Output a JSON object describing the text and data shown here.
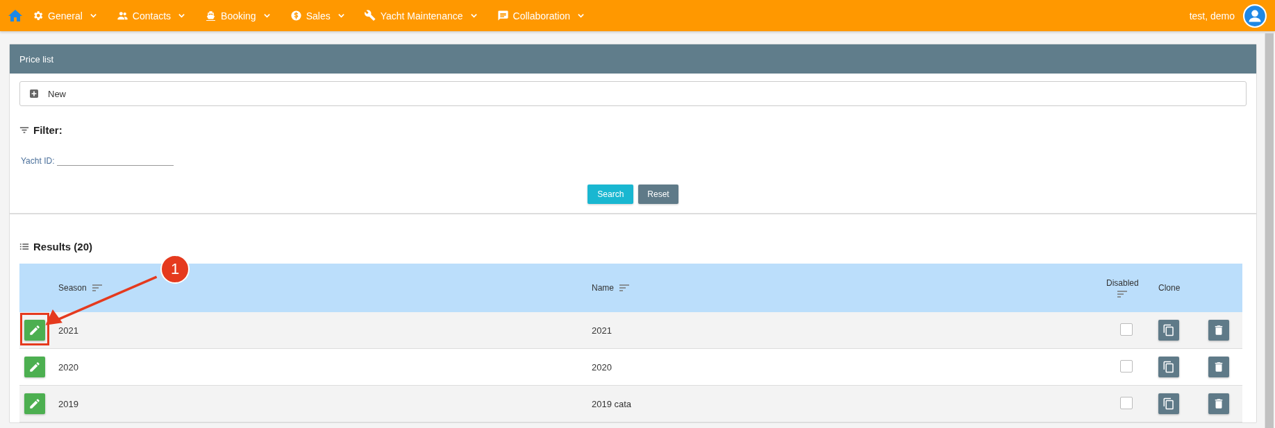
{
  "nav": {
    "items": [
      {
        "label": "General"
      },
      {
        "label": "Contacts"
      },
      {
        "label": "Booking"
      },
      {
        "label": "Sales"
      },
      {
        "label": "Yacht Maintenance"
      },
      {
        "label": "Collaboration"
      }
    ],
    "user": "test, demo"
  },
  "panel": {
    "title": "Price list",
    "new_button": "New",
    "filter_title": "Filter:",
    "filter_field": {
      "label": "Yacht ID:"
    },
    "search_button": "Search",
    "reset_button": "Reset",
    "results_title": "Results (20)"
  },
  "table": {
    "columns": [
      {
        "label": "Season",
        "sortable": true
      },
      {
        "label": "Name",
        "sortable": true
      },
      {
        "label": "Disabled",
        "sortable": true
      },
      {
        "label": "Clone",
        "sortable": false
      }
    ],
    "rows": [
      {
        "season": "2021",
        "name": "2021",
        "disabled": false,
        "highlighted": true
      },
      {
        "season": "2020",
        "name": "2020",
        "disabled": false,
        "highlighted": false
      },
      {
        "season": "2019",
        "name": "2019 cata",
        "disabled": false,
        "highlighted": false
      }
    ]
  },
  "annotation": {
    "label": "1"
  }
}
